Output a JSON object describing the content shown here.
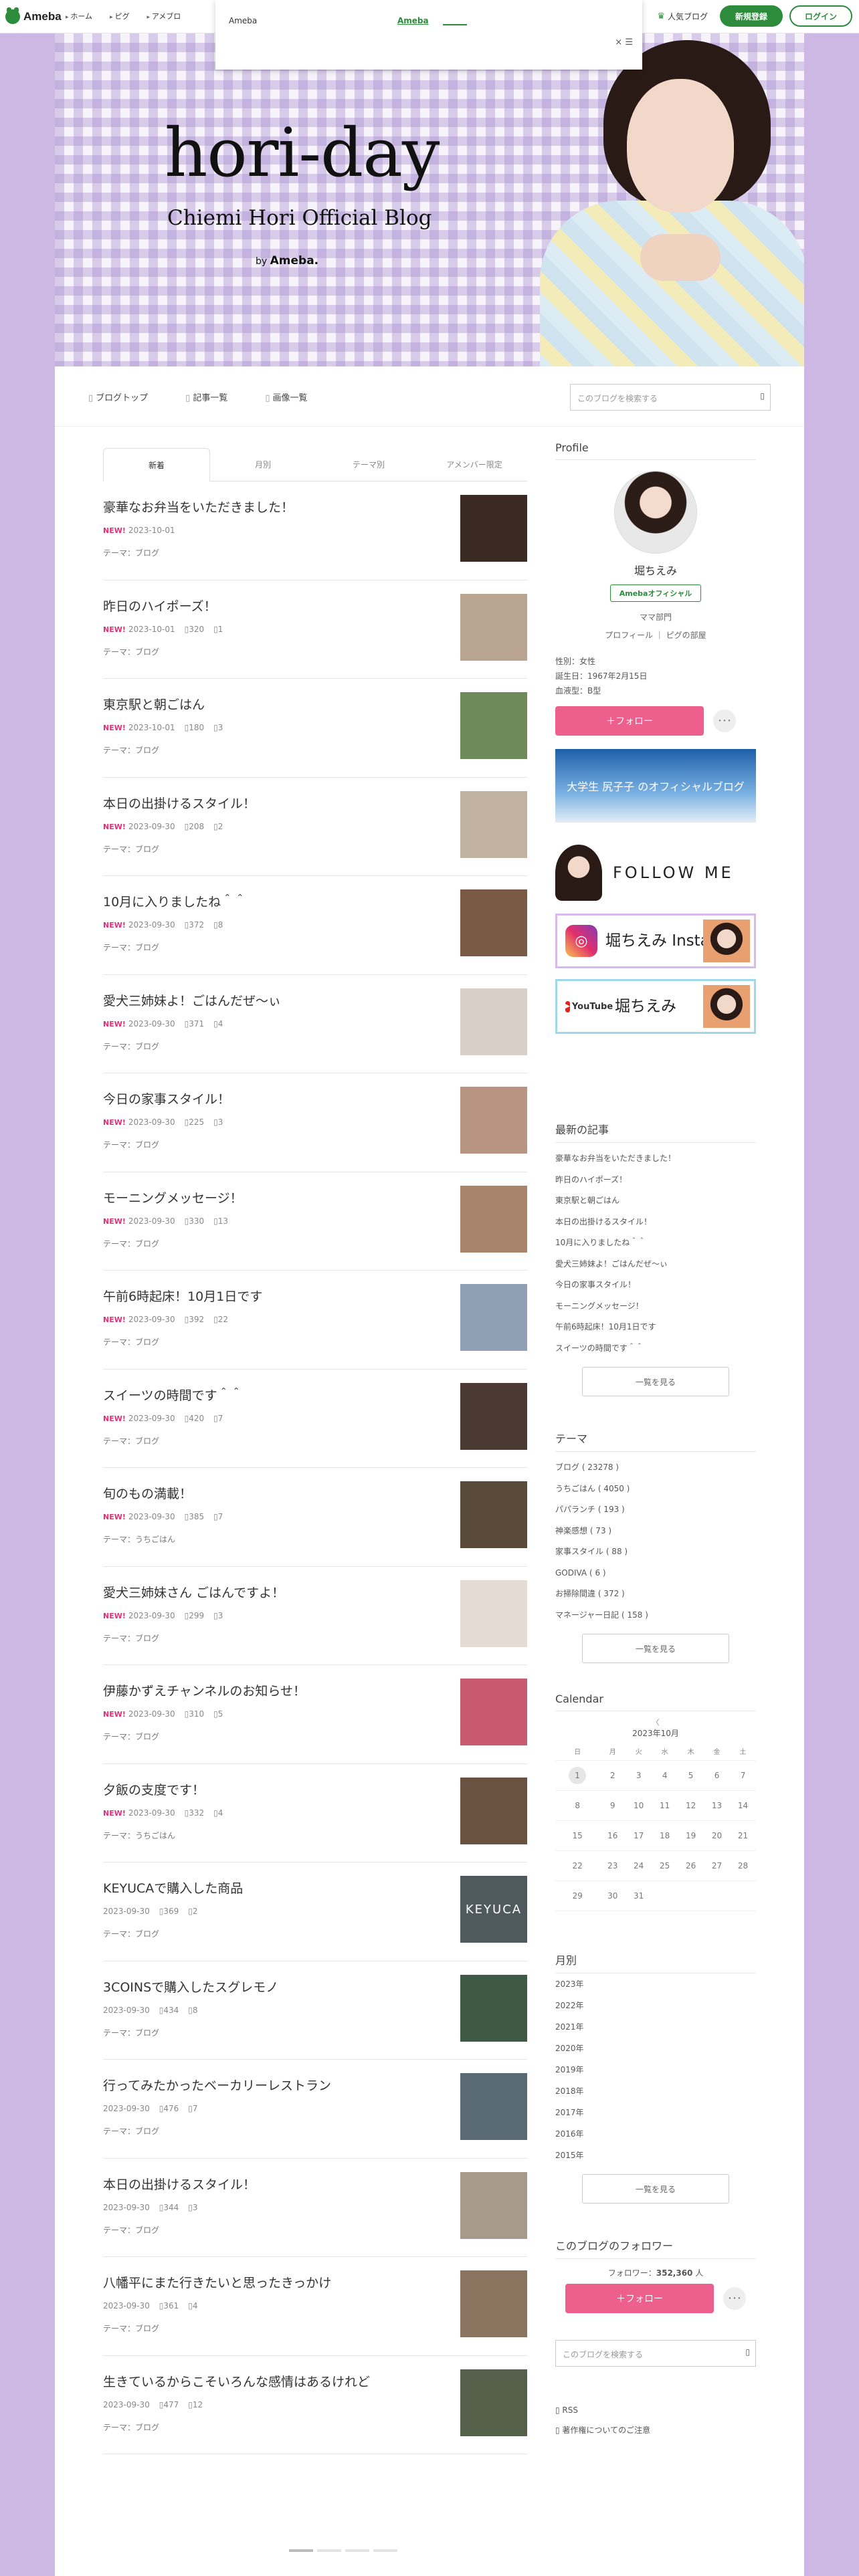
{
  "global_header": {
    "logo": "Ameba",
    "nav": [
      "ホーム",
      "ピグ",
      "アメブロ"
    ],
    "popular": "人気ブログ",
    "register": "新規登録",
    "login": "ログイン"
  },
  "popup": {
    "label": "Ameba",
    "link": "Ameba",
    "close": "×"
  },
  "blog_header": {
    "title": "hori-day",
    "subtitle": "Chiemi Hori Official Blog",
    "by_prefix": "by",
    "by_brand": "Ameba."
  },
  "blog_nav": {
    "links": [
      "ブログトップ",
      "記事一覧",
      "画像一覧"
    ],
    "search_placeholder": "このブログを検索する"
  },
  "tabs": [
    "新着",
    "月別",
    "テーマ別",
    "アメンバー限定"
  ],
  "entries": [
    {
      "title": "豪華なお弁当をいただきました！",
      "new": "NEW!",
      "date": "2023-10-01",
      "likes": "",
      "comments": "",
      "theme": "テーマ：ブログ",
      "thumb": "#3a2a22"
    },
    {
      "title": "昨日のハイポーズ！",
      "new": "NEW!",
      "date": "2023-10-01",
      "likes": "320",
      "comments": "1",
      "theme": "テーマ：ブログ",
      "thumb": "#b8a490"
    },
    {
      "title": "東京駅と朝ごはん",
      "new": "NEW!",
      "date": "2023-10-01",
      "likes": "180",
      "comments": "3",
      "theme": "テーマ：ブログ",
      "thumb": "#6f8a5a"
    },
    {
      "title": "本日の出掛けるスタイル！",
      "new": "NEW!",
      "date": "2023-09-30",
      "likes": "208",
      "comments": "2",
      "theme": "テーマ：ブログ",
      "thumb": "#c2b2a0"
    },
    {
      "title": "10月に入りましたね＾＾",
      "new": "NEW!",
      "date": "2023-09-30",
      "likes": "372",
      "comments": "8",
      "theme": "テーマ：ブログ",
      "thumb": "#7a5a44"
    },
    {
      "title": "愛犬三姉妹よ！ごはんだぜ〜ぃ",
      "new": "NEW!",
      "date": "2023-09-30",
      "likes": "371",
      "comments": "4",
      "theme": "テーマ：ブログ",
      "thumb": "#d8d0c8"
    },
    {
      "title": "今日の家事スタイル！",
      "new": "NEW!",
      "date": "2023-09-30",
      "likes": "225",
      "comments": "3",
      "theme": "テーマ：ブログ",
      "thumb": "#b89482"
    },
    {
      "title": "モーニングメッセージ！",
      "new": "NEW!",
      "date": "2023-09-30",
      "likes": "330",
      "comments": "13",
      "theme": "テーマ：ブログ",
      "thumb": "#a8846c"
    },
    {
      "title": "午前6時起床！10月1日です",
      "new": "NEW!",
      "date": "2023-09-30",
      "likes": "392",
      "comments": "22",
      "theme": "テーマ：ブログ",
      "thumb": "#8fa0b4"
    },
    {
      "title": "スイーツの時間です＾＾",
      "new": "NEW!",
      "date": "2023-09-30",
      "likes": "420",
      "comments": "7",
      "theme": "テーマ：ブログ",
      "thumb": "#4a3a32"
    },
    {
      "title": "旬のもの満載！",
      "new": "NEW!",
      "date": "2023-09-30",
      "likes": "385",
      "comments": "7",
      "theme": "テーマ：うちごはん",
      "thumb": "#5a4a3a"
    },
    {
      "title": "愛犬三姉妹さん ごはんですよ！",
      "new": "NEW!",
      "date": "2023-09-30",
      "likes": "299",
      "comments": "3",
      "theme": "テーマ：ブログ",
      "thumb": "#e4dcd4"
    },
    {
      "title": "伊藤かずえチャンネルのお知らせ！",
      "new": "NEW!",
      "date": "2023-09-30",
      "likes": "310",
      "comments": "5",
      "theme": "テーマ：ブログ",
      "thumb": "#c85a70"
    },
    {
      "title": "夕飯の支度です！",
      "new": "NEW!",
      "date": "2023-09-30",
      "likes": "332",
      "comments": "4",
      "theme": "テーマ：うちごはん",
      "thumb": "#6a5240"
    },
    {
      "title": "KEYUCAで購入した商品",
      "new": "",
      "date": "2023-09-30",
      "likes": "369",
      "comments": "2",
      "theme": "テーマ：ブログ",
      "thumb": "#4f5a5e",
      "thumb_text": "KEYUCA"
    },
    {
      "title": "3COINSで購入したスグレモノ",
      "new": "",
      "date": "2023-09-30",
      "likes": "434",
      "comments": "8",
      "theme": "テーマ：ブログ",
      "thumb": "#3e5a44"
    },
    {
      "title": "行ってみたかったベーカリーレストラン",
      "new": "",
      "date": "2023-09-30",
      "likes": "476",
      "comments": "7",
      "theme": "テーマ：ブログ",
      "thumb": "#5a6a74"
    },
    {
      "title": "本日の出掛けるスタイル！",
      "new": "",
      "date": "2023-09-30",
      "likes": "344",
      "comments": "3",
      "theme": "テーマ：ブログ",
      "thumb": "#a89a8a"
    },
    {
      "title": "八幡平にまた行きたいと思ったきっかけ",
      "new": "",
      "date": "2023-09-30",
      "likes": "361",
      "comments": "4",
      "theme": "テーマ：ブログ",
      "thumb": "#8a7460"
    },
    {
      "title": "生きているからこそいろんな感情はあるけれど",
      "new": "",
      "date": "2023-09-30",
      "likes": "477",
      "comments": "12",
      "theme": "テーマ：ブログ",
      "thumb": "#54604a"
    }
  ],
  "profile": {
    "heading": "Profile",
    "name": "堀ちえみ",
    "badge": "Amebaオフィシャル",
    "category": "ママ部門",
    "links": "プロフィール ｜ ピグの部屋",
    "gender": "性別：女性",
    "birthday": "誕生日：1967年2月15日",
    "blood": "血液型：B型",
    "follow": "＋フォロー",
    "more": "･･･"
  },
  "banners": {
    "b1": "大学生 尻子子 のオフィシャルブログ",
    "b2": "FOLLOW ME",
    "b3": "堀ちえみ Instagram",
    "b4_brand": "YouTube",
    "b4": "堀ちえみ"
  },
  "recent": {
    "heading": "最新の記事",
    "items": [
      "豪華なお弁当をいただきました！",
      "昨日のハイポーズ！",
      "東京駅と朝ごはん",
      "本日の出掛けるスタイル！",
      "10月に入りましたね＾＾",
      "愛犬三姉妹よ！ごはんだぜ〜ぃ",
      "今日の家事スタイル！",
      "モーニングメッセージ！",
      "午前6時起床！10月1日です",
      "スイーツの時間です＾＾"
    ],
    "more": "一覧を見る"
  },
  "themes": {
    "heading": "テーマ",
    "items": [
      "ブログ ( 23278 )",
      "うちごはん ( 4050 )",
      "パパランチ ( 193 )",
      "神楽感想 ( 73 )",
      "家事スタイル ( 88 )",
      "GODIVA ( 6 )",
      "お掃除間違 ( 372 )",
      "マネージャー日記 ( 158 )"
    ],
    "more": "一覧を見る"
  },
  "calendar": {
    "heading": "Calendar",
    "nav": "〈",
    "month": "2023年10月",
    "weekdays": [
      "日",
      "月",
      "火",
      "水",
      "木",
      "金",
      "土"
    ],
    "weeks": [
      [
        "1",
        "2",
        "3",
        "4",
        "5",
        "6",
        "7"
      ],
      [
        "8",
        "9",
        "10",
        "11",
        "12",
        "13",
        "14"
      ],
      [
        "15",
        "16",
        "17",
        "18",
        "19",
        "20",
        "21"
      ],
      [
        "22",
        "23",
        "24",
        "25",
        "26",
        "27",
        "28"
      ],
      [
        "29",
        "30",
        "31",
        "",
        "",
        "",
        ""
      ]
    ]
  },
  "monthly": {
    "heading": "月別",
    "items": [
      "2023年",
      "2022年",
      "2021年",
      "2020年",
      "2019年",
      "2018年",
      "2017年",
      "2016年",
      "2015年"
    ],
    "more": "一覧を見る"
  },
  "followers": {
    "heading": "このブログのフォロワー",
    "label": "フォロワー：",
    "count": "352,360",
    "unit": "人",
    "follow": "＋フォロー",
    "more": "･･･"
  },
  "footer": {
    "search_placeholder": "このブログを検索する",
    "rss": "RSS",
    "copyright": "著作権についてのご注意"
  }
}
